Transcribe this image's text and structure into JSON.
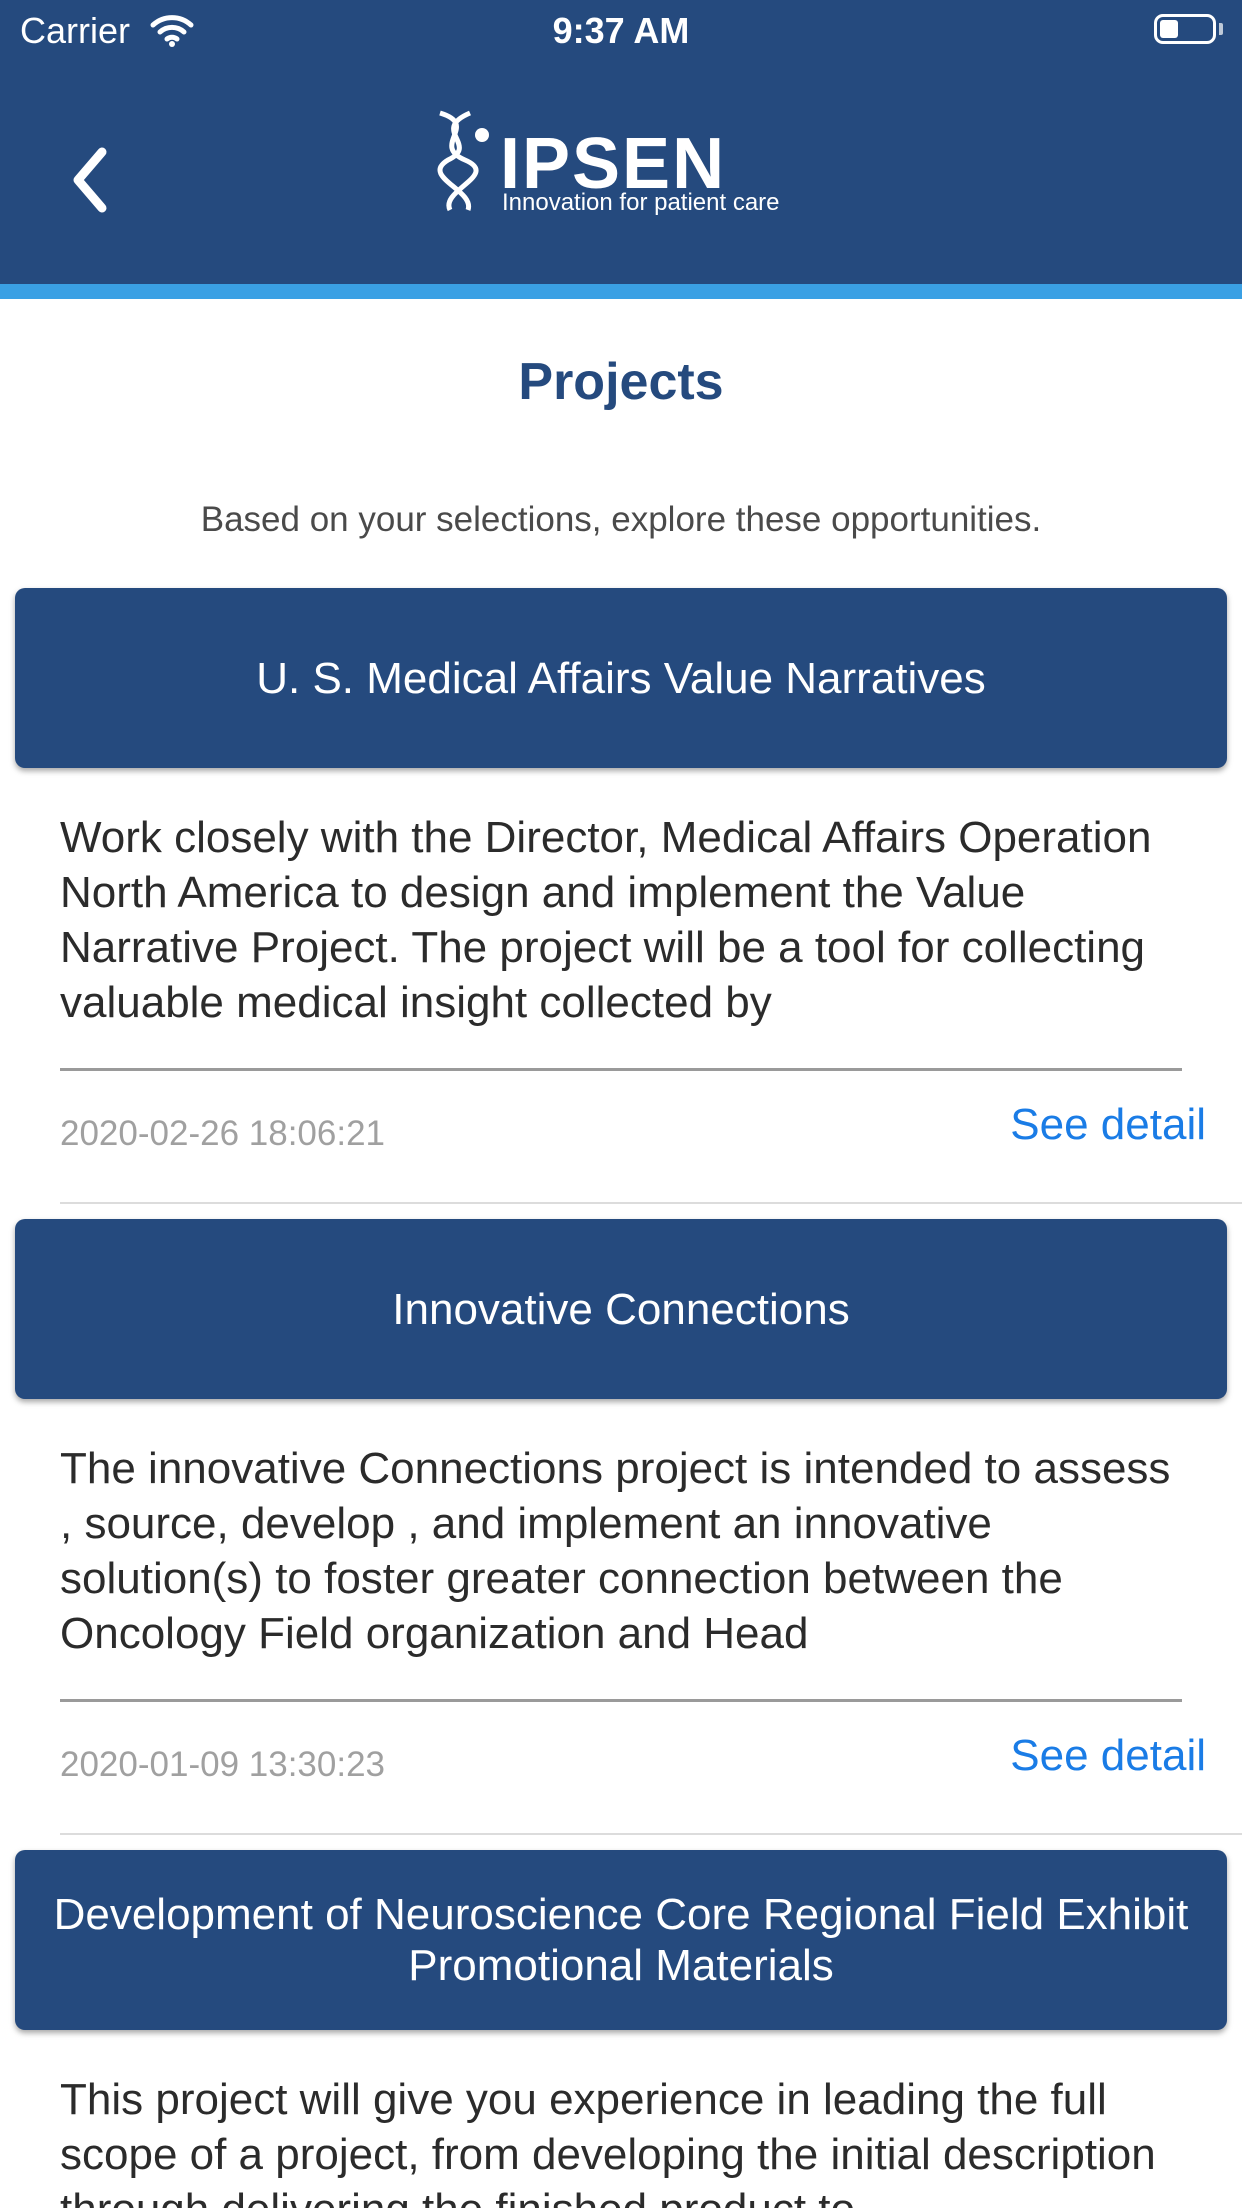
{
  "status_bar": {
    "carrier": "Carrier",
    "time": "9:37 AM",
    "wifi_icon": "wifi-icon",
    "battery_icon": "battery-icon"
  },
  "header": {
    "back_icon": "chevron-left-icon",
    "logo_word": "IPSEN",
    "logo_tagline": "Innovation for patient care",
    "bg_color": "#254a7e",
    "accent_color": "#3aa0e4"
  },
  "page": {
    "title": "Projects",
    "subtitle": "Based on your selections, explore these opportunities."
  },
  "projects": [
    {
      "title": "U. S. Medical Affairs Value Narratives",
      "description": "Work closely with the Director, Medical Affairs Operation North America to design and implement the Value Narrative Project. The project will be a tool for collecting valuable medical insight collected by",
      "date": "2020-02-26 18:06:21",
      "link": "See detail"
    },
    {
      "title": "Innovative Connections",
      "description": "The innovative Connections project is intended to assess , source, develop , and implement an innovative solution(s) to foster greater connection between the Oncology Field organization and Head",
      "date": "2020-01-09 13:30:23",
      "link": "See detail"
    },
    {
      "title": "Development of Neuroscience Core Regional Field Exhibit Promotional Materials",
      "description": "This project will give you experience in leading the full scope of a project, from developing the initial description through delivering the finished product to",
      "date": "",
      "link": ""
    }
  ],
  "colors": {
    "link": "#1a7ce6",
    "title": "#254a7e"
  }
}
